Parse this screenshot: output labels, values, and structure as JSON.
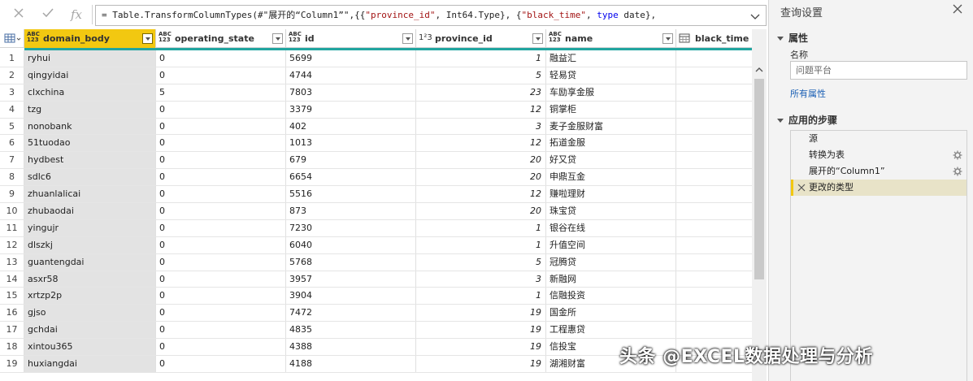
{
  "formula_bar": {
    "cancel_icon": "close-icon",
    "confirm_icon": "check-icon",
    "fx_label": "fx",
    "formula_prefix": "= Table.TransformColumnTypes(#\"展开的“Column1”\",{{",
    "formula_s1": "\"province_id\"",
    "formula_mid1": ", Int64.Type}, {",
    "formula_s2": "\"black_time\"",
    "formula_mid2": ", ",
    "formula_kw": "type",
    "formula_tail": " date},"
  },
  "table": {
    "columns": [
      {
        "type_label_top": "ABC",
        "type_label_bottom": "123",
        "name": "domain_body"
      },
      {
        "type_label_top": "ABC",
        "type_label_bottom": "123",
        "name": "operating_state"
      },
      {
        "type_label_top": "ABC",
        "type_label_bottom": "123",
        "name": "id"
      },
      {
        "type_label": "1²3",
        "name": "province_id"
      },
      {
        "type_label_top": "ABC",
        "type_label_bottom": "123",
        "name": "name"
      },
      {
        "type_label": "date",
        "name": "black_time"
      }
    ],
    "rows": [
      [
        "1",
        "ryhui",
        "0",
        "5699",
        "1",
        "融益汇"
      ],
      [
        "2",
        "qingyidai",
        "0",
        "4744",
        "5",
        "轻易贷"
      ],
      [
        "3",
        "clxchina",
        "5",
        "7803",
        "23",
        "车励享金服"
      ],
      [
        "4",
        "tzg",
        "0",
        "3379",
        "12",
        "铜掌柜"
      ],
      [
        "5",
        "nonobank",
        "0",
        "402",
        "3",
        "麦子金服财富"
      ],
      [
        "6",
        "51tuodao",
        "0",
        "1013",
        "12",
        "拓道金服"
      ],
      [
        "7",
        "hydbest",
        "0",
        "679",
        "20",
        "好又贷"
      ],
      [
        "8",
        "sdlc6",
        "0",
        "6654",
        "20",
        "申鼎互金"
      ],
      [
        "9",
        "zhuanlalicai",
        "0",
        "5516",
        "12",
        "赚啦理财"
      ],
      [
        "10",
        "zhubaodai",
        "0",
        "873",
        "20",
        "珠宝贷"
      ],
      [
        "11",
        "yingujr",
        "0",
        "7230",
        "1",
        "银谷在线"
      ],
      [
        "12",
        "dlszkj",
        "0",
        "6040",
        "1",
        "升值空间"
      ],
      [
        "13",
        "guantengdai",
        "0",
        "5768",
        "5",
        "冠腾贷"
      ],
      [
        "14",
        "asxr58",
        "0",
        "3957",
        "3",
        "新融网"
      ],
      [
        "15",
        "xrtzp2p",
        "0",
        "3904",
        "1",
        "信融投资"
      ],
      [
        "16",
        "gjso",
        "0",
        "7472",
        "19",
        "国金所"
      ],
      [
        "17",
        "gchdai",
        "0",
        "4835",
        "19",
        "工程惠贷"
      ],
      [
        "18",
        "xintou365",
        "0",
        "4388",
        "19",
        "信投宝"
      ],
      [
        "19",
        "huxiangdai",
        "0",
        "4188",
        "19",
        "湖湘财富"
      ]
    ]
  },
  "settings": {
    "title": "查询设置",
    "properties_header": "属性",
    "name_label": "名称",
    "name_value": "问题平台",
    "all_properties_link": "所有属性",
    "steps_header": "应用的步骤",
    "steps": [
      {
        "label": "源",
        "has_gear": false
      },
      {
        "label": "转换为表",
        "has_gear": true
      },
      {
        "label": "展开的“Column1”",
        "has_gear": true
      },
      {
        "label": "更改的类型",
        "has_gear": false,
        "active": true
      }
    ]
  },
  "watermark": "头条 @EXCEL数据处理与分析",
  "colors": {
    "accent_yellow": "#f2c811",
    "accent_teal": "#21a5a0",
    "link_blue": "#1a5fb4"
  }
}
